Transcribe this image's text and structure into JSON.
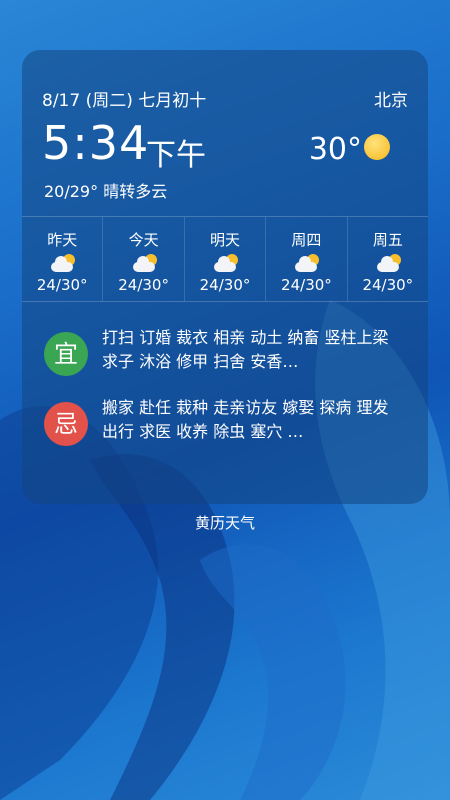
{
  "widget": {
    "date": "8/17 (周二) 七月初十",
    "city": "北京",
    "time": "5:34",
    "ampm": "下午",
    "current_temp": "30°",
    "current_icon": "sun-icon",
    "summary": "20/29° 晴转多云",
    "forecast": [
      {
        "day": "昨天",
        "icon": "partly-cloudy-icon",
        "temp": "24/30°"
      },
      {
        "day": "今天",
        "icon": "partly-cloudy-icon",
        "temp": "24/30°"
      },
      {
        "day": "明天",
        "icon": "partly-cloudy-icon",
        "temp": "24/30°"
      },
      {
        "day": "周四",
        "icon": "partly-cloudy-icon",
        "temp": "24/30°"
      },
      {
        "day": "周五",
        "icon": "partly-cloudy-icon",
        "temp": "24/30°"
      }
    ],
    "almanac": {
      "good_char": "宜",
      "good_text": "打扫 订婚 裁衣 相亲 动土 纳畜 竖柱上梁 求子 沐浴 修甲 扫舍 安香…",
      "bad_char": "忌",
      "bad_text": "搬家 赴任 栽种 走亲访友 嫁娶 探病 理发 出行 求医 收养 除虫 塞穴 …"
    }
  },
  "widget_label": "黄历天气",
  "colors": {
    "good": "#3aa552",
    "bad": "#e2514a",
    "sun": "#f6b71d"
  }
}
